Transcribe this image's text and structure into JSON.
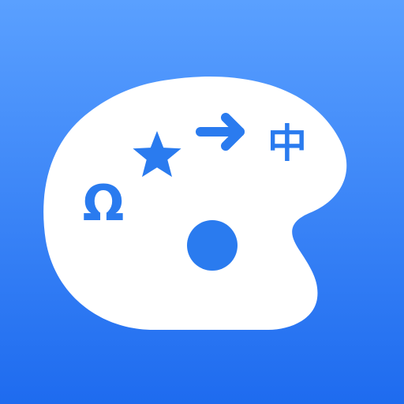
{
  "app_icon": {
    "icon_name": "palette-icon",
    "colors": {
      "background_top": "#5AA0FF",
      "background_bottom": "#1E6BEF",
      "palette": "#FFFFFF",
      "symbol": "#2A7BEF"
    },
    "symbols": {
      "omega": "Ω",
      "star": "★",
      "arrow": "→",
      "chinese": "中"
    }
  }
}
